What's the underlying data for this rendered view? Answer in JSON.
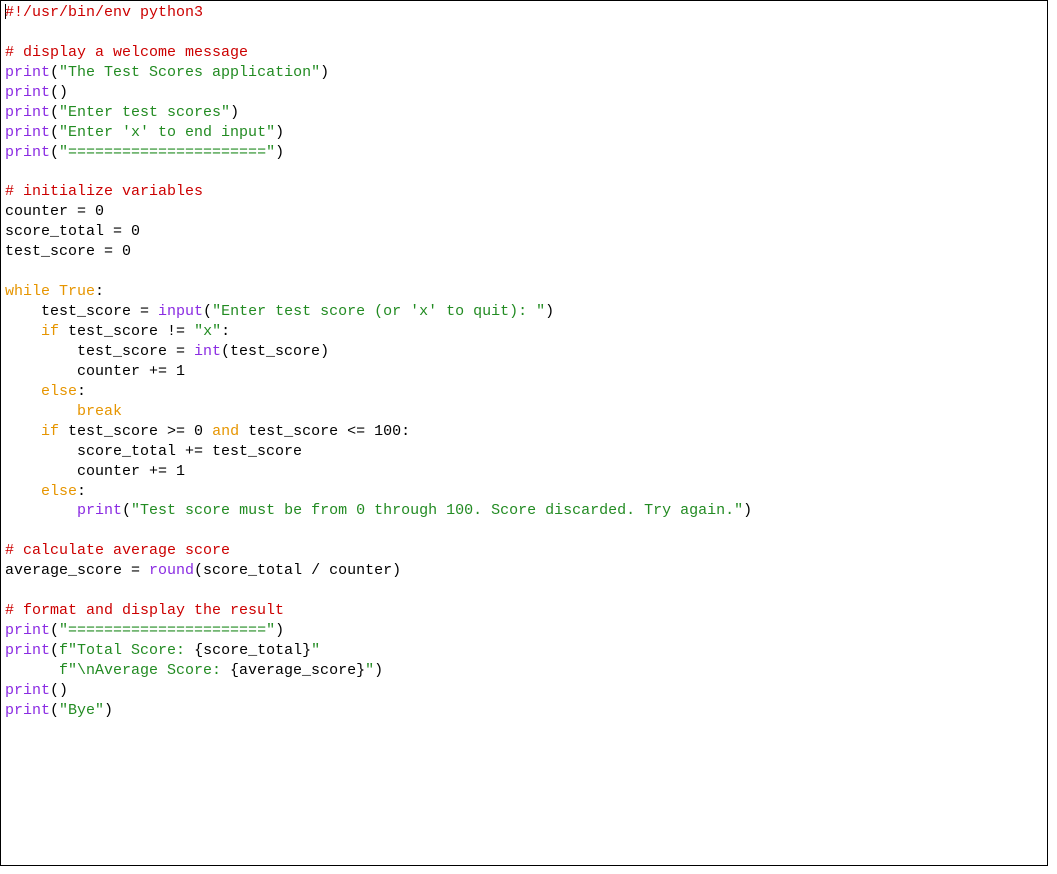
{
  "tokens": [
    [
      {
        "t": "|",
        "cls": "cursor"
      },
      {
        "t": "#!/usr/bin/env python3",
        "cls": "c-comment"
      }
    ],
    [
      {
        "t": "",
        "cls": "c-default"
      }
    ],
    [
      {
        "t": "# display a welcome message",
        "cls": "c-comment"
      }
    ],
    [
      {
        "t": "print",
        "cls": "c-builtin"
      },
      {
        "t": "(",
        "cls": "c-default"
      },
      {
        "t": "\"The Test Scores application\"",
        "cls": "c-string"
      },
      {
        "t": ")",
        "cls": "c-default"
      }
    ],
    [
      {
        "t": "print",
        "cls": "c-builtin"
      },
      {
        "t": "()",
        "cls": "c-default"
      }
    ],
    [
      {
        "t": "print",
        "cls": "c-builtin"
      },
      {
        "t": "(",
        "cls": "c-default"
      },
      {
        "t": "\"Enter test scores\"",
        "cls": "c-string"
      },
      {
        "t": ")",
        "cls": "c-default"
      }
    ],
    [
      {
        "t": "print",
        "cls": "c-builtin"
      },
      {
        "t": "(",
        "cls": "c-default"
      },
      {
        "t": "\"Enter 'x' to end input\"",
        "cls": "c-string"
      },
      {
        "t": ")",
        "cls": "c-default"
      }
    ],
    [
      {
        "t": "print",
        "cls": "c-builtin"
      },
      {
        "t": "(",
        "cls": "c-default"
      },
      {
        "t": "\"======================\"",
        "cls": "c-string"
      },
      {
        "t": ")",
        "cls": "c-default"
      }
    ],
    [
      {
        "t": "",
        "cls": "c-default"
      }
    ],
    [
      {
        "t": "# initialize variables",
        "cls": "c-comment"
      }
    ],
    [
      {
        "t": "counter = 0",
        "cls": "c-default"
      }
    ],
    [
      {
        "t": "score_total = 0",
        "cls": "c-default"
      }
    ],
    [
      {
        "t": "test_score = 0",
        "cls": "c-default"
      }
    ],
    [
      {
        "t": "",
        "cls": "c-default"
      }
    ],
    [
      {
        "t": "while",
        "cls": "c-keyword"
      },
      {
        "t": " ",
        "cls": "c-default"
      },
      {
        "t": "True",
        "cls": "c-keyword"
      },
      {
        "t": ":",
        "cls": "c-default"
      }
    ],
    [
      {
        "t": "    test_score = ",
        "cls": "c-default"
      },
      {
        "t": "input",
        "cls": "c-builtin"
      },
      {
        "t": "(",
        "cls": "c-default"
      },
      {
        "t": "\"Enter test score (or 'x' to quit): \"",
        "cls": "c-string"
      },
      {
        "t": ")",
        "cls": "c-default"
      }
    ],
    [
      {
        "t": "    ",
        "cls": "c-default"
      },
      {
        "t": "if",
        "cls": "c-keyword"
      },
      {
        "t": " test_score != ",
        "cls": "c-default"
      },
      {
        "t": "\"x\"",
        "cls": "c-string"
      },
      {
        "t": ":",
        "cls": "c-default"
      }
    ],
    [
      {
        "t": "        test_score = ",
        "cls": "c-default"
      },
      {
        "t": "int",
        "cls": "c-builtin"
      },
      {
        "t": "(test_score)",
        "cls": "c-default"
      }
    ],
    [
      {
        "t": "        counter += 1",
        "cls": "c-default"
      }
    ],
    [
      {
        "t": "    ",
        "cls": "c-default"
      },
      {
        "t": "else",
        "cls": "c-keyword"
      },
      {
        "t": ":",
        "cls": "c-default"
      }
    ],
    [
      {
        "t": "        ",
        "cls": "c-default"
      },
      {
        "t": "break",
        "cls": "c-keyword"
      }
    ],
    [
      {
        "t": "    ",
        "cls": "c-default"
      },
      {
        "t": "if",
        "cls": "c-keyword"
      },
      {
        "t": " test_score >= 0 ",
        "cls": "c-default"
      },
      {
        "t": "and",
        "cls": "c-keyword"
      },
      {
        "t": " test_score <= 100:",
        "cls": "c-default"
      }
    ],
    [
      {
        "t": "        score_total += test_score",
        "cls": "c-default"
      }
    ],
    [
      {
        "t": "        counter += 1",
        "cls": "c-default"
      }
    ],
    [
      {
        "t": "    ",
        "cls": "c-default"
      },
      {
        "t": "else",
        "cls": "c-keyword"
      },
      {
        "t": ":",
        "cls": "c-default"
      }
    ],
    [
      {
        "t": "        ",
        "cls": "c-default"
      },
      {
        "t": "print",
        "cls": "c-builtin"
      },
      {
        "t": "(",
        "cls": "c-default"
      },
      {
        "t": "\"Test score must be from 0 through 100. Score discarded. Try again.\"",
        "cls": "c-string"
      },
      {
        "t": ")",
        "cls": "c-default"
      }
    ],
    [
      {
        "t": "",
        "cls": "c-default"
      }
    ],
    [
      {
        "t": "# calculate average score",
        "cls": "c-comment"
      }
    ],
    [
      {
        "t": "average_score = ",
        "cls": "c-default"
      },
      {
        "t": "round",
        "cls": "c-builtin"
      },
      {
        "t": "(score_total / counter)",
        "cls": "c-default"
      }
    ],
    [
      {
        "t": "",
        "cls": "c-default"
      }
    ],
    [
      {
        "t": "# format and display the result",
        "cls": "c-comment"
      }
    ],
    [
      {
        "t": "print",
        "cls": "c-builtin"
      },
      {
        "t": "(",
        "cls": "c-default"
      },
      {
        "t": "\"======================\"",
        "cls": "c-string"
      },
      {
        "t": ")",
        "cls": "c-default"
      }
    ],
    [
      {
        "t": "print",
        "cls": "c-builtin"
      },
      {
        "t": "(",
        "cls": "c-default"
      },
      {
        "t": "f\"Total Score: ",
        "cls": "c-string"
      },
      {
        "t": "{score_total}",
        "cls": "c-default"
      },
      {
        "t": "\"",
        "cls": "c-string"
      }
    ],
    [
      {
        "t": "      ",
        "cls": "c-default"
      },
      {
        "t": "f\"\\nAverage Score: ",
        "cls": "c-string"
      },
      {
        "t": "{average_score}",
        "cls": "c-default"
      },
      {
        "t": "\"",
        "cls": "c-string"
      },
      {
        "t": ")",
        "cls": "c-default"
      }
    ],
    [
      {
        "t": "print",
        "cls": "c-builtin"
      },
      {
        "t": "()",
        "cls": "c-default"
      }
    ],
    [
      {
        "t": "print",
        "cls": "c-builtin"
      },
      {
        "t": "(",
        "cls": "c-default"
      },
      {
        "t": "\"Bye\"",
        "cls": "c-string"
      },
      {
        "t": ")",
        "cls": "c-default"
      }
    ]
  ]
}
